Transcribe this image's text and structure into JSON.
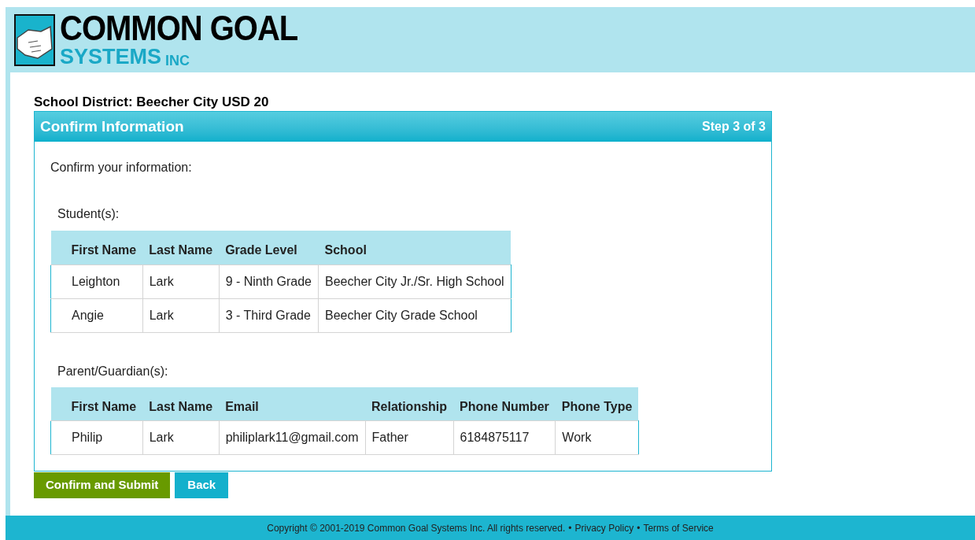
{
  "logo": {
    "line_1": "COMMON GOAL",
    "line_2": "SYSTEMS",
    "line_2_suffix": "INC"
  },
  "district": "School District: Beecher City USD 20",
  "panel": {
    "title": "Confirm Information",
    "step": "Step 3 of 3",
    "intro": "Confirm your information:"
  },
  "students": {
    "label": "Student(s):",
    "columns": [
      "First Name",
      "Last Name",
      "Grade Level",
      "School"
    ],
    "rows": [
      [
        "Leighton",
        "Lark",
        "9 - Ninth Grade",
        "Beecher City Jr./Sr. High School"
      ],
      [
        "Angie",
        "Lark",
        "3 - Third Grade",
        "Beecher City Grade School"
      ]
    ]
  },
  "guardians": {
    "label": "Parent/Guardian(s):",
    "columns": [
      "First Name",
      "Last Name",
      "Email",
      "Relationship",
      "Phone Number",
      "Phone Type"
    ],
    "rows": [
      [
        "Philip",
        "Lark",
        "philiplark11@gmail.com",
        "Father",
        "6184875117",
        "Work"
      ]
    ]
  },
  "buttons": [
    {
      "label": "Confirm and Submit",
      "kind": "primary"
    },
    {
      "label": "Back",
      "kind": "secondary"
    }
  ],
  "footer": {
    "copyright": "Copyright © 2001-2019 Common Goal Systems Inc. All rights reserved.",
    "separator_1": "•",
    "link_1": "Privacy Policy",
    "separator_2": "•",
    "link_2": "Terms of Service"
  }
}
